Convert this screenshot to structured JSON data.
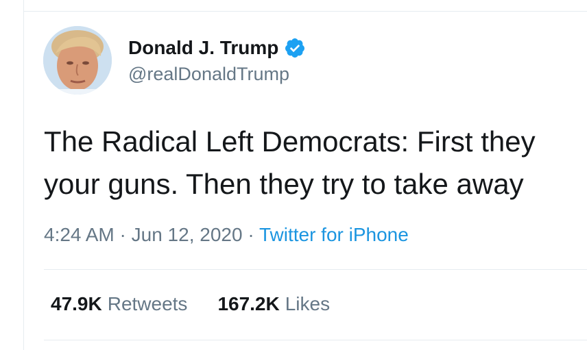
{
  "author": {
    "display_name": "Donald J. Trump",
    "handle": "@realDonaldTrump",
    "verified": true
  },
  "tweet": {
    "lines": [
      "The Radical Left Democrats: First they",
      "your guns. Then they try to take away"
    ],
    "time": "4:24 AM",
    "separator_1": " · ",
    "date": "Jun 12, 2020",
    "separator_2": " · ",
    "source": "Twitter for iPhone"
  },
  "stats": {
    "retweets_count": "47.9K",
    "retweets_label": "Retweets",
    "likes_count": "167.2K",
    "likes_label": "Likes"
  },
  "colors": {
    "text_primary": "#14171a",
    "text_secondary": "#657786",
    "link": "#1b95e0",
    "verified_badge": "#1da1f2",
    "divider": "#e6ecf0"
  },
  "icons": {
    "verified": "verified-badge-icon",
    "avatar": "profile-photo"
  }
}
